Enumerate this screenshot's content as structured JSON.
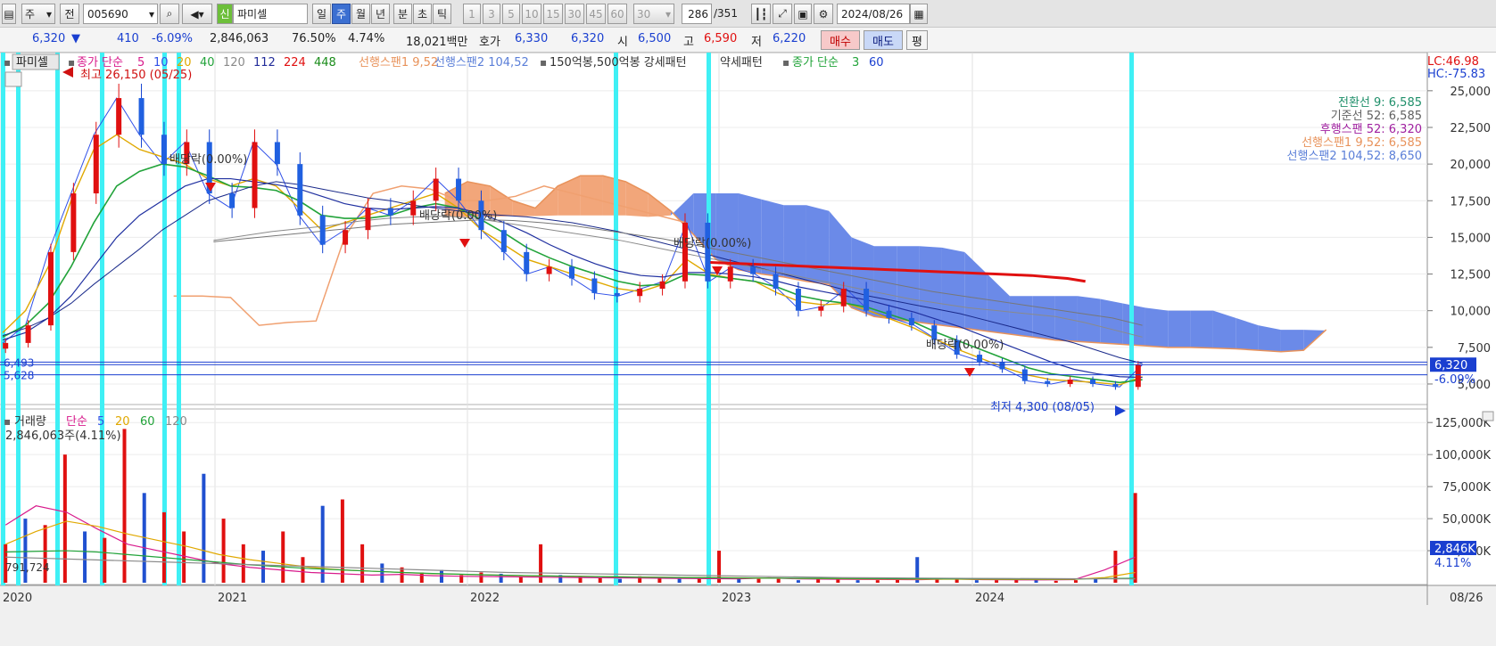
{
  "toolbar": {
    "period_week": "주",
    "prev": "전",
    "code": "005690",
    "credit_badge": "신",
    "name": "파미셀",
    "periods": [
      "일",
      "주",
      "월",
      "년",
      "분",
      "초",
      "틱"
    ],
    "active_period": "주",
    "minute_steps": [
      "1",
      "3",
      "5",
      "10",
      "15",
      "30",
      "45",
      "60"
    ],
    "minute_select": "30",
    "count": "286",
    "count_total": "/351",
    "date": "2024/08/26"
  },
  "quote": {
    "price": "6,320",
    "change_arrow": "▼",
    "change": "410",
    "change_pct": "-6.09%",
    "volume": "2,846,063",
    "ratio": "76.50%",
    "turnover": "4.74%",
    "amount": "18,021백만",
    "ask_label": "호가",
    "ask": "6,330",
    "bid": "6,320",
    "open_label": "시",
    "open": "6,500",
    "high_label": "고",
    "high": "6,590",
    "low_label": "저",
    "low": "6,220",
    "buy": "매수",
    "sell": "매도",
    "eval": "평"
  },
  "legend": {
    "title": "파미셀",
    "ma_label": "종가 단순",
    "ma_periods": [
      "5",
      "10",
      "20",
      "40",
      "120",
      "112",
      "224",
      "448"
    ],
    "ma_colors": [
      "#d81b8c",
      "#3050e8",
      "#e0a800",
      "#22a33a",
      "#8a8a8a",
      "#222c9a",
      "#e01010",
      "#1a8c1a"
    ],
    "span1": "선행스팬1 9,52",
    "span2": "선행스팬2 104,52",
    "pattern": "150억봉,500억봉 강세패턴",
    "weak": "약세패턴",
    "ma2_label": "종가 단순",
    "ma2_periods": [
      "3",
      "60"
    ]
  },
  "lc": "LC:46.98",
  "hc": "HC:-75.83",
  "ichimoku": [
    {
      "label": "전환선 9: 6,585",
      "color": "#1f8f6a"
    },
    {
      "label": "기준선 52: 6,585",
      "color": "#606060"
    },
    {
      "label": "후행스팬 52: 6,320",
      "color": "#a020a0"
    },
    {
      "label": "선행스팬1 9,52: 6,585",
      "color": "#e8925a"
    },
    {
      "label": "선행스팬2 104,52: 8,650",
      "color": "#5b7fd8"
    }
  ],
  "annotations": {
    "high": "최고 26,150 (05/25)",
    "low": "최저 4,300 (08/05)",
    "div1": "배당락(0.00%)",
    "div2": "배당락(0.00%)",
    "div3": "배당락(0.00%)",
    "div4": "배당락(0.00%)",
    "level1": "6,493",
    "level2": "5,628",
    "price_tag": "6,320",
    "pct_tag": "-6.09%"
  },
  "volume_legend": {
    "title": "거래량",
    "ma_label": "단순",
    "periods": [
      "5",
      "20",
      "60",
      "120"
    ],
    "current": "2,846,063주(4.11%)",
    "left_label": "791,724",
    "tag": "2,846K",
    "tag_pct": "4.11%"
  },
  "xaxis": {
    "labels": [
      "2020",
      "2021",
      "2022",
      "2023",
      "2024"
    ],
    "right_label": "08/26"
  },
  "chart_data": {
    "type": "line",
    "title": "파미셀",
    "price": {
      "yticks": [
        5000,
        7500,
        10000,
        12500,
        15000,
        17500,
        20000,
        22500,
        25000
      ],
      "ytick_labels": [
        "5,000",
        "7,500",
        "10,000",
        "12,500",
        "15,000",
        "17,500",
        "20,000",
        "22,500",
        "25,000"
      ],
      "ylim": [
        3600,
        27300
      ],
      "series": [
        {
          "values": [
            7800,
            9000,
            14000,
            18000,
            22000,
            24500,
            22000,
            20000,
            21500,
            18000,
            17000,
            21500,
            20000,
            16500,
            14500,
            15500,
            17000,
            16500,
            17500,
            19000,
            17500,
            15500,
            14000,
            12500,
            13000,
            12200,
            11200,
            11000,
            11500,
            12000,
            16000,
            12000,
            13000,
            12500,
            11500,
            10000,
            10300,
            11500,
            10000,
            9500,
            9000,
            8000,
            7000,
            6500,
            6000,
            5200,
            5000,
            5300,
            5000,
            4800,
            6320
          ]
        },
        {
          "values": [
            8500,
            10000,
            13000,
            17500,
            21000,
            22000,
            21000,
            20500,
            20000,
            19000,
            18500,
            19000,
            18500,
            17000,
            15500,
            16000,
            16500,
            17000,
            17500,
            18000,
            17000,
            15500,
            14500,
            13500,
            13000,
            12500,
            12000,
            11500,
            11300,
            11800,
            13500,
            12500,
            12200,
            12000,
            11200,
            10600,
            10400,
            10500,
            10000,
            9400,
            8800,
            8000,
            7300,
            6700,
            6100,
            5600,
            5300,
            5200,
            5100,
            4950,
            5500
          ]
        },
        {
          "values": [
            8200,
            9000,
            10500,
            13000,
            16000,
            18500,
            19500,
            20000,
            19800,
            19200,
            18500,
            18400,
            18200,
            17500,
            16500,
            16300,
            16300,
            16500,
            17000,
            17300,
            17000,
            16200,
            15300,
            14300,
            13600,
            13000,
            12500,
            12000,
            11700,
            11800,
            12500,
            12400,
            12200,
            12000,
            11600,
            11000,
            10700,
            10500,
            10200,
            9700,
            9200,
            8500,
            7900,
            7300,
            6700,
            6100,
            5700,
            5500,
            5300,
            5100,
            5300
          ]
        },
        {
          "values": [
            8000,
            8500,
            9500,
            11000,
            13000,
            15000,
            16500,
            17500,
            18500,
            19000,
            19000,
            18800,
            18600,
            18300,
            17800,
            17300,
            17000,
            16900,
            17000,
            17100,
            17000,
            16600,
            16000,
            15300,
            14500,
            13800,
            13200,
            12700,
            12400,
            12300,
            12600,
            12600,
            12500,
            12300,
            12000,
            11600,
            11300,
            11000,
            10700,
            10300,
            9900,
            9400,
            8900,
            8300,
            7700,
            7100,
            6500,
            6000,
            5700,
            5500,
            5450
          ]
        },
        {
          "values": [
            8300,
            8800,
            9500,
            10500,
            11800,
            13000,
            14200,
            15500,
            16500,
            17500,
            18000,
            18500,
            18800,
            18600,
            18300,
            18000,
            17700,
            17500,
            17200,
            17000,
            16800,
            16600,
            16500,
            16400,
            16200,
            16000,
            15700,
            15400,
            15000,
            14600,
            14200,
            13800,
            13400,
            13000,
            12600,
            12200,
            11800,
            11400,
            11000,
            10700,
            10400,
            10100,
            9800,
            9400,
            9000,
            8600,
            8200,
            7800,
            7300,
            6800,
            6400
          ]
        },
        {
          "values": [
            14800,
            15100,
            15400,
            15600,
            15800,
            16100,
            16300,
            16400,
            16450,
            16300,
            16000,
            15700,
            15400,
            15100,
            14800,
            14400,
            14000,
            13600,
            13200,
            12800,
            12400,
            12000,
            11600,
            11200,
            10800,
            10500,
            10200,
            10000,
            9800,
            9600,
            9200,
            8700,
            8200
          ]
        },
        {
          "values": [
            14700,
            14900,
            15100,
            15300,
            15500,
            15700,
            15900,
            16000,
            16100,
            16200,
            16150,
            16000,
            15800,
            15500,
            15200,
            14900,
            14500,
            14100,
            13700,
            13300,
            12900,
            12500,
            12100,
            11700,
            11300,
            11000,
            10700,
            10400,
            10100,
            9800,
            9500,
            9000
          ]
        },
        {
          "values": [
            13300,
            13250,
            13200,
            13150,
            13100,
            13050,
            13000,
            12950,
            12900,
            12850,
            12800,
            12750,
            12700,
            12650,
            12600,
            12550,
            12500,
            12450,
            12400,
            12300,
            12200,
            12000
          ]
        }
      ],
      "cloud_span1": [
        null,
        null,
        null,
        null,
        null,
        null,
        null,
        null,
        null,
        null,
        null,
        null,
        18000,
        18800,
        18500,
        17500,
        17000,
        18500,
        19200,
        19200,
        18800,
        18000,
        16800,
        15200,
        13500,
        12800,
        12500,
        12300,
        12000,
        11800,
        10200,
        9600,
        9400,
        9200,
        9000,
        8800,
        8600,
        8400,
        8200,
        8000,
        7900,
        7800,
        7700,
        7600,
        7500,
        7500,
        7450,
        7400,
        7300,
        7200,
        7300,
        8700
      ],
      "cloud_span2": [
        null,
        null,
        null,
        null,
        null,
        null,
        null,
        null,
        null,
        null,
        null,
        null,
        16400,
        16400,
        16400,
        16450,
        16450,
        16500,
        16500,
        16500,
        16500,
        16400,
        16500,
        18000,
        18000,
        18000,
        17600,
        17200,
        17200,
        16800,
        15000,
        14400,
        14400,
        14400,
        14300,
        14000,
        12500,
        11000,
        11000,
        11000,
        11000,
        10800,
        10500,
        10200,
        10000,
        10000,
        10000,
        9500,
        9000,
        8700,
        8700,
        8650
      ],
      "lagging": [
        11000,
        11000,
        10900,
        9000,
        9200,
        9300,
        15000,
        18000,
        18500,
        18300,
        17500,
        17500,
        17800,
        18500,
        18000,
        17500,
        17000,
        16500,
        16000
      ]
    },
    "volume": {
      "yticks": [
        25000,
        50000,
        75000,
        100000,
        125000
      ],
      "ytick_labels": [
        "25,000K",
        "50,000K",
        "75,000K",
        "100,000K",
        "125,000K"
      ],
      "ylim": [
        0,
        130000
      ],
      "bars": [
        30000,
        50000,
        45000,
        100000,
        40000,
        35000,
        120000,
        70000,
        55000,
        40000,
        85000,
        50000,
        30000,
        25000,
        40000,
        20000,
        60000,
        65000,
        30000,
        15000,
        12000,
        8000,
        10000,
        6000,
        8000,
        7000,
        5000,
        30000,
        6000,
        5000,
        4000,
        3000,
        5000,
        4000,
        3000,
        4000,
        25000,
        4000,
        3000,
        3000,
        2000,
        3000,
        2500,
        2000,
        2000,
        3000,
        20000,
        2500,
        3000,
        2000,
        2000,
        3000,
        2000,
        1500,
        2000,
        3000,
        25000,
        70000
      ],
      "ma5": [
        45000,
        60000,
        55000,
        42000,
        30000,
        25000,
        20000,
        15000,
        12000,
        10000,
        8000,
        7000,
        6000,
        6500,
        5500,
        5000,
        4800,
        4500,
        4200,
        4000,
        3800,
        3600,
        3400,
        3200,
        3000,
        3800,
        3000,
        2800,
        2600,
        2500,
        2400,
        3000,
        2400,
        2300,
        2200,
        2400,
        10000,
        20000
      ],
      "ma20": [
        30000,
        40000,
        48000,
        44000,
        38000,
        33000,
        28000,
        22000,
        18000,
        15000,
        12000,
        10000,
        9000,
        8000,
        7000,
        6500,
        6000,
        5500,
        5200,
        5000,
        4700,
        4400,
        4200,
        4000,
        3800,
        3600,
        3400,
        3200,
        3000,
        2900,
        2800,
        2800,
        2700,
        2600,
        2600,
        2700,
        4000,
        8000
      ],
      "ma60": [
        24000,
        24500,
        25000,
        24000,
        22000,
        20000,
        18000,
        16000,
        14000,
        12500,
        11000,
        10000,
        9000,
        8000,
        7200,
        6600,
        6000,
        5600,
        5200,
        4900,
        4600,
        4300,
        4100,
        3900,
        3700,
        3600,
        3500,
        3400,
        3300,
        3200,
        3100,
        3050,
        3000,
        2950,
        2900,
        2900,
        3200,
        3500
      ],
      "ma120": [
        20000,
        19000,
        18000,
        17000,
        16000,
        15000,
        14000,
        13000,
        12000,
        11000,
        10000,
        9000,
        8000,
        7500,
        7000,
        6500,
        6000,
        5500,
        5000,
        4500,
        4000,
        3800,
        3600,
        3400,
        3300,
        3200,
        3100,
        3000
      ]
    },
    "x_labels": [
      "2020",
      "2021",
      "2022",
      "2023",
      "2024"
    ]
  }
}
